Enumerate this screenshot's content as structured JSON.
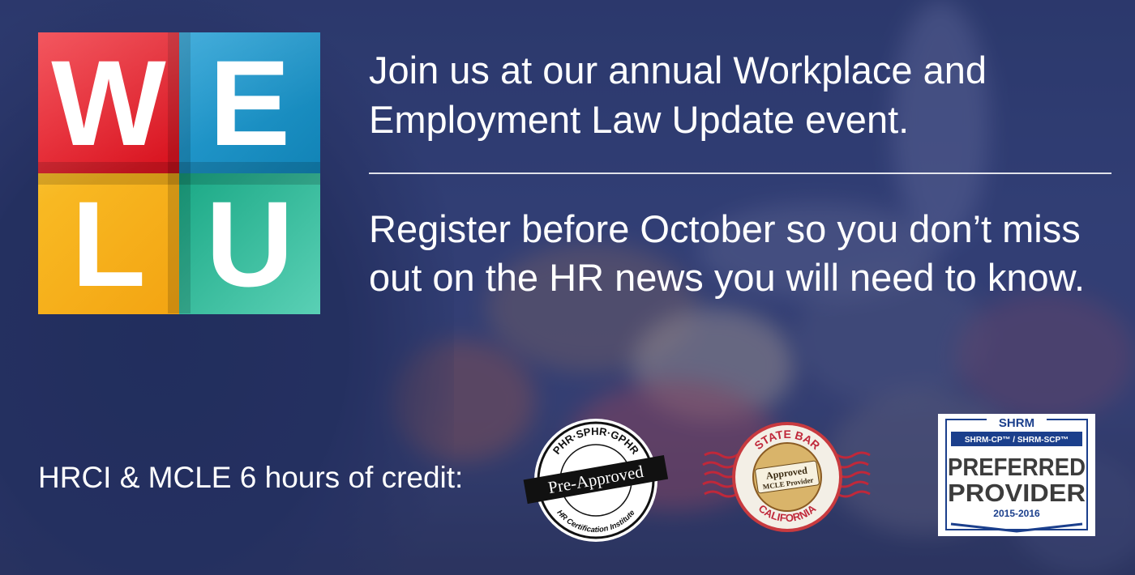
{
  "logo": {
    "letters": [
      "W",
      "E",
      "L",
      "U"
    ],
    "colors": [
      "#e11e28",
      "#1b8fc4",
      "#f6b01a",
      "#2bb596"
    ]
  },
  "headline": "Join us at our annual Workplace and Employment Law Update event.",
  "subline": "Register before October so you don’t miss out on the HR news you will need to know.",
  "credit": "HRCI & MCLE 6 hours of credit:",
  "badges": {
    "hrci": {
      "top_text": "PHR·SPHR·GPHR",
      "band_text": "Pre-Approved",
      "bottom_text": "HR Certification Institute"
    },
    "state_bar": {
      "top_text": "STATE BAR",
      "center_line1": "Approved",
      "center_line2": "MCLE Provider",
      "bottom_text": "CALIFORNIA"
    },
    "shrm": {
      "header": "SHRM",
      "sub": "SHRM-CP™ / SHRM-SCP™",
      "line1": "PREFERRED",
      "line2": "PROVIDER",
      "years": "2015-2016"
    }
  }
}
